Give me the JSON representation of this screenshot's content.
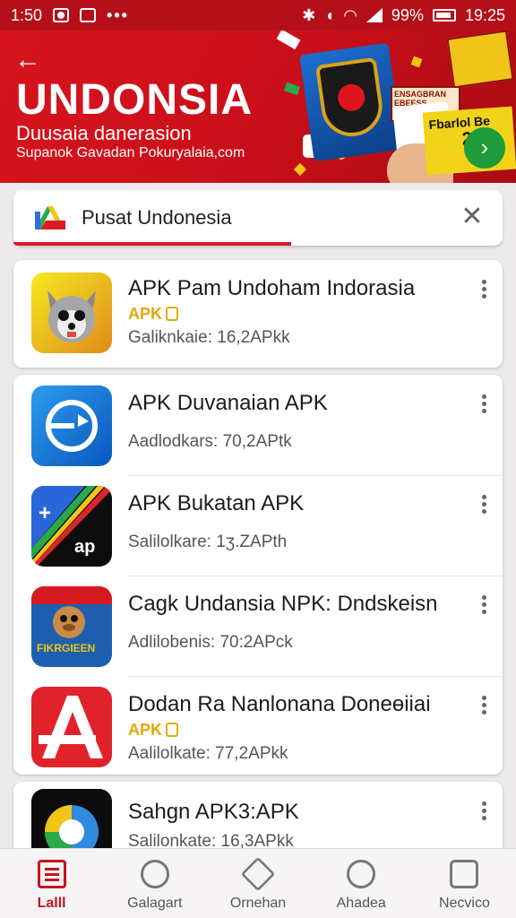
{
  "status_bar": {
    "time_left": "1:50",
    "battery": "99%",
    "time_right": "19:25"
  },
  "banner": {
    "title": "UNDONSIA",
    "subtitle": "Duusaia danerasion",
    "url_text": "Supanok Gavadan Pokuryalaia,com",
    "promo_text_1": "ENSAGBRAN EBEESS",
    "promo_text_2": "Fbarlol Be",
    "promo_number": "20"
  },
  "search": {
    "label": "Pusat Undonesia",
    "close_icon": "close-icon"
  },
  "apps": [
    {
      "name": "APK Pam Undoham Indorasia",
      "tag": "APK",
      "meta": "Galiknkaie: 16,2APkk",
      "icon": "wolf-face-icon",
      "icon_colors": [
        "#f2e21a",
        "#e0751a"
      ]
    },
    {
      "name": "APK Duvanaian APK",
      "tag": "",
      "meta": "Aadlodkars: 70,2APtk",
      "icon": "refresh-clock-icon",
      "icon_colors": [
        "#1e8ee0",
        "#0b5cbf"
      ]
    },
    {
      "name": "APK Bukatan APK",
      "tag": "",
      "meta": "Salilolkare: 1ʒ.ZAPth",
      "icon": "ap-stripes-icon",
      "icon_colors": [
        "#0d0d0d",
        "#2a66d8"
      ]
    },
    {
      "name": "Cagk Undansia NPK: Dndskeisn",
      "tag": "",
      "meta": "Adlilobenis: 70:2APck",
      "icon": "cartoon-character-icon",
      "icon_colors": [
        "#1d5fae",
        "#d71a20"
      ],
      "icon_text": "FIKRGIEEN"
    },
    {
      "name": "Dodan Ra Nanlonana Doneɵiiai",
      "tag": "APK",
      "meta": "Aalilolkate: 77,2APkk",
      "icon": "red-a-icon",
      "icon_colors": [
        "#e0232b",
        "#ffffff"
      ]
    },
    {
      "name": "Sahgn APK3:APK",
      "tag": "",
      "meta": "Salilonkate: 16,3APkk",
      "icon": "colorful-circle-icon",
      "icon_colors": [
        "#0c0c0c",
        "#2f8be0"
      ]
    }
  ],
  "nav": [
    {
      "label": "Lalll",
      "icon": "home-icon",
      "active": true
    },
    {
      "label": "Galagart",
      "icon": "refresh-icon",
      "active": false
    },
    {
      "label": "Ornehan",
      "icon": "house-icon",
      "active": false
    },
    {
      "label": "Ahadea",
      "icon": "smile-icon",
      "active": false
    },
    {
      "label": "Necvico",
      "icon": "device-icon",
      "active": false
    }
  ],
  "colors": {
    "brand_red": "#c8141d",
    "banner_red": "#d8141e",
    "tag_gold": "#e3a90b"
  }
}
